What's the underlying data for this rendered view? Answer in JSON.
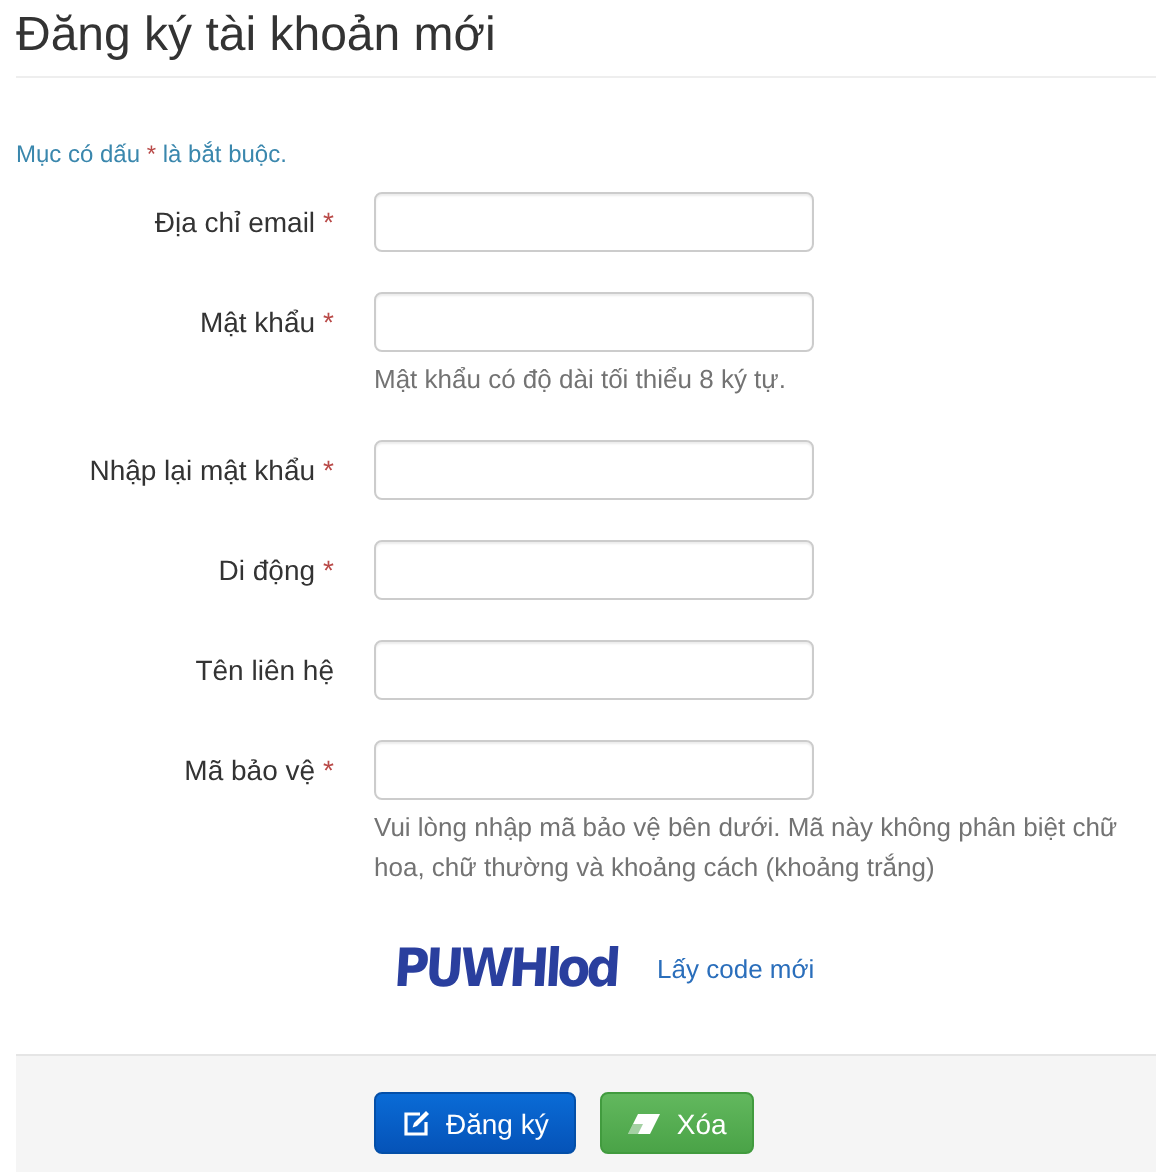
{
  "title": "Đăng ký tài khoản mới",
  "required_note": {
    "before": "Mục có dấu",
    "mark": "*",
    "after": "là bắt buộc."
  },
  "fields": [
    {
      "label": "Địa chỉ email",
      "required_mark": "*"
    },
    {
      "label": "Mật khẩu",
      "required_mark": "*",
      "help": "Mật khẩu có độ dài tối thiểu 8 ký tự."
    },
    {
      "label": "Nhập lại mật khẩu",
      "required_mark": "*"
    },
    {
      "label": "Di động",
      "required_mark": "*"
    },
    {
      "label": "Tên liên hệ"
    },
    {
      "label": "Mã bảo vệ",
      "required_mark": "*",
      "help": "Vui lòng nhập mã bảo vệ bên dưới. Mã này không phân biệt chữ hoa, chữ thường và khoảng cách (khoảng trắng)"
    }
  ],
  "captcha": {
    "code": "PUWHlod",
    "refresh_link": "Lấy code mới"
  },
  "buttons": [
    {
      "label": "Đăng ký",
      "kind": "submit"
    },
    {
      "label": "Xóa",
      "kind": "reset"
    }
  ]
}
